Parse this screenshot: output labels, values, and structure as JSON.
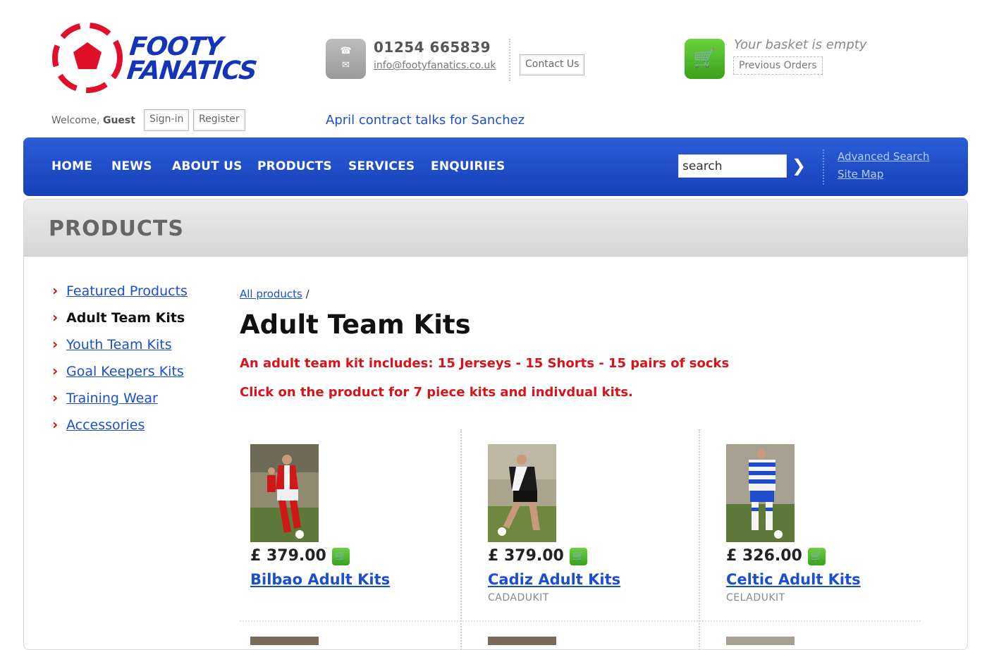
{
  "brand": {
    "line1": "FOOTY",
    "line2": "FANATICS",
    "red": "#e0102a",
    "blue": "#1535b8"
  },
  "header": {
    "phone": "01254 665839",
    "email": "info@footyfanatics.co.uk",
    "contact_button": "Contact Us",
    "basket_status": "Your basket is empty",
    "previous_orders": "Previous Orders",
    "welcome_prefix": "Welcome,",
    "welcome_user": "Guest",
    "signin_button": "Sign-in",
    "register_button": "Register",
    "news_ticker": "April contract talks for Sanchez"
  },
  "nav": {
    "items": [
      "HOME",
      "NEWS",
      "ABOUT US",
      "PRODUCTS",
      "SERVICES",
      "ENQUIRIES"
    ],
    "search_value": "search",
    "advanced_search": "Advanced Search",
    "site_map": "Site Map",
    "bar_color": "#1f4ccb"
  },
  "section_title": "PRODUCTS",
  "sidebar": {
    "items": [
      {
        "label": "Featured Products",
        "active": false
      },
      {
        "label": "Adult Team Kits",
        "active": true
      },
      {
        "label": "Youth Team Kits",
        "active": false
      },
      {
        "label": "Goal Keepers Kits",
        "active": false
      },
      {
        "label": "Training Wear",
        "active": false
      },
      {
        "label": "Accessories",
        "active": false
      }
    ]
  },
  "main": {
    "breadcrumb_link": "All products",
    "breadcrumb_sep": "/",
    "title": "Adult Team Kits",
    "note1": "An adult team kit includes: 15 Jerseys - 15 Shorts - 15 pairs of socks",
    "note2": "Click on the product for 7 piece kits and indivdual kits.",
    "products": [
      {
        "price": "£ 379.00",
        "name": "Bilbao Adult Kits",
        "code": "",
        "kit": "red-white"
      },
      {
        "price": "£ 379.00",
        "name": "Cadiz Adult Kits",
        "code": "CADADUKIT",
        "kit": "black-white"
      },
      {
        "price": "£ 326.00",
        "name": "Celtic Adult Kits",
        "code": "CELADUKIT",
        "kit": "blue-hoops"
      }
    ]
  },
  "icons": {
    "phone": "phone-icon",
    "mail": "mail-icon",
    "basket": "shopping-cart-icon",
    "search_go": "chevron-right-icon",
    "side_bullet": "chevron-right-icon"
  }
}
